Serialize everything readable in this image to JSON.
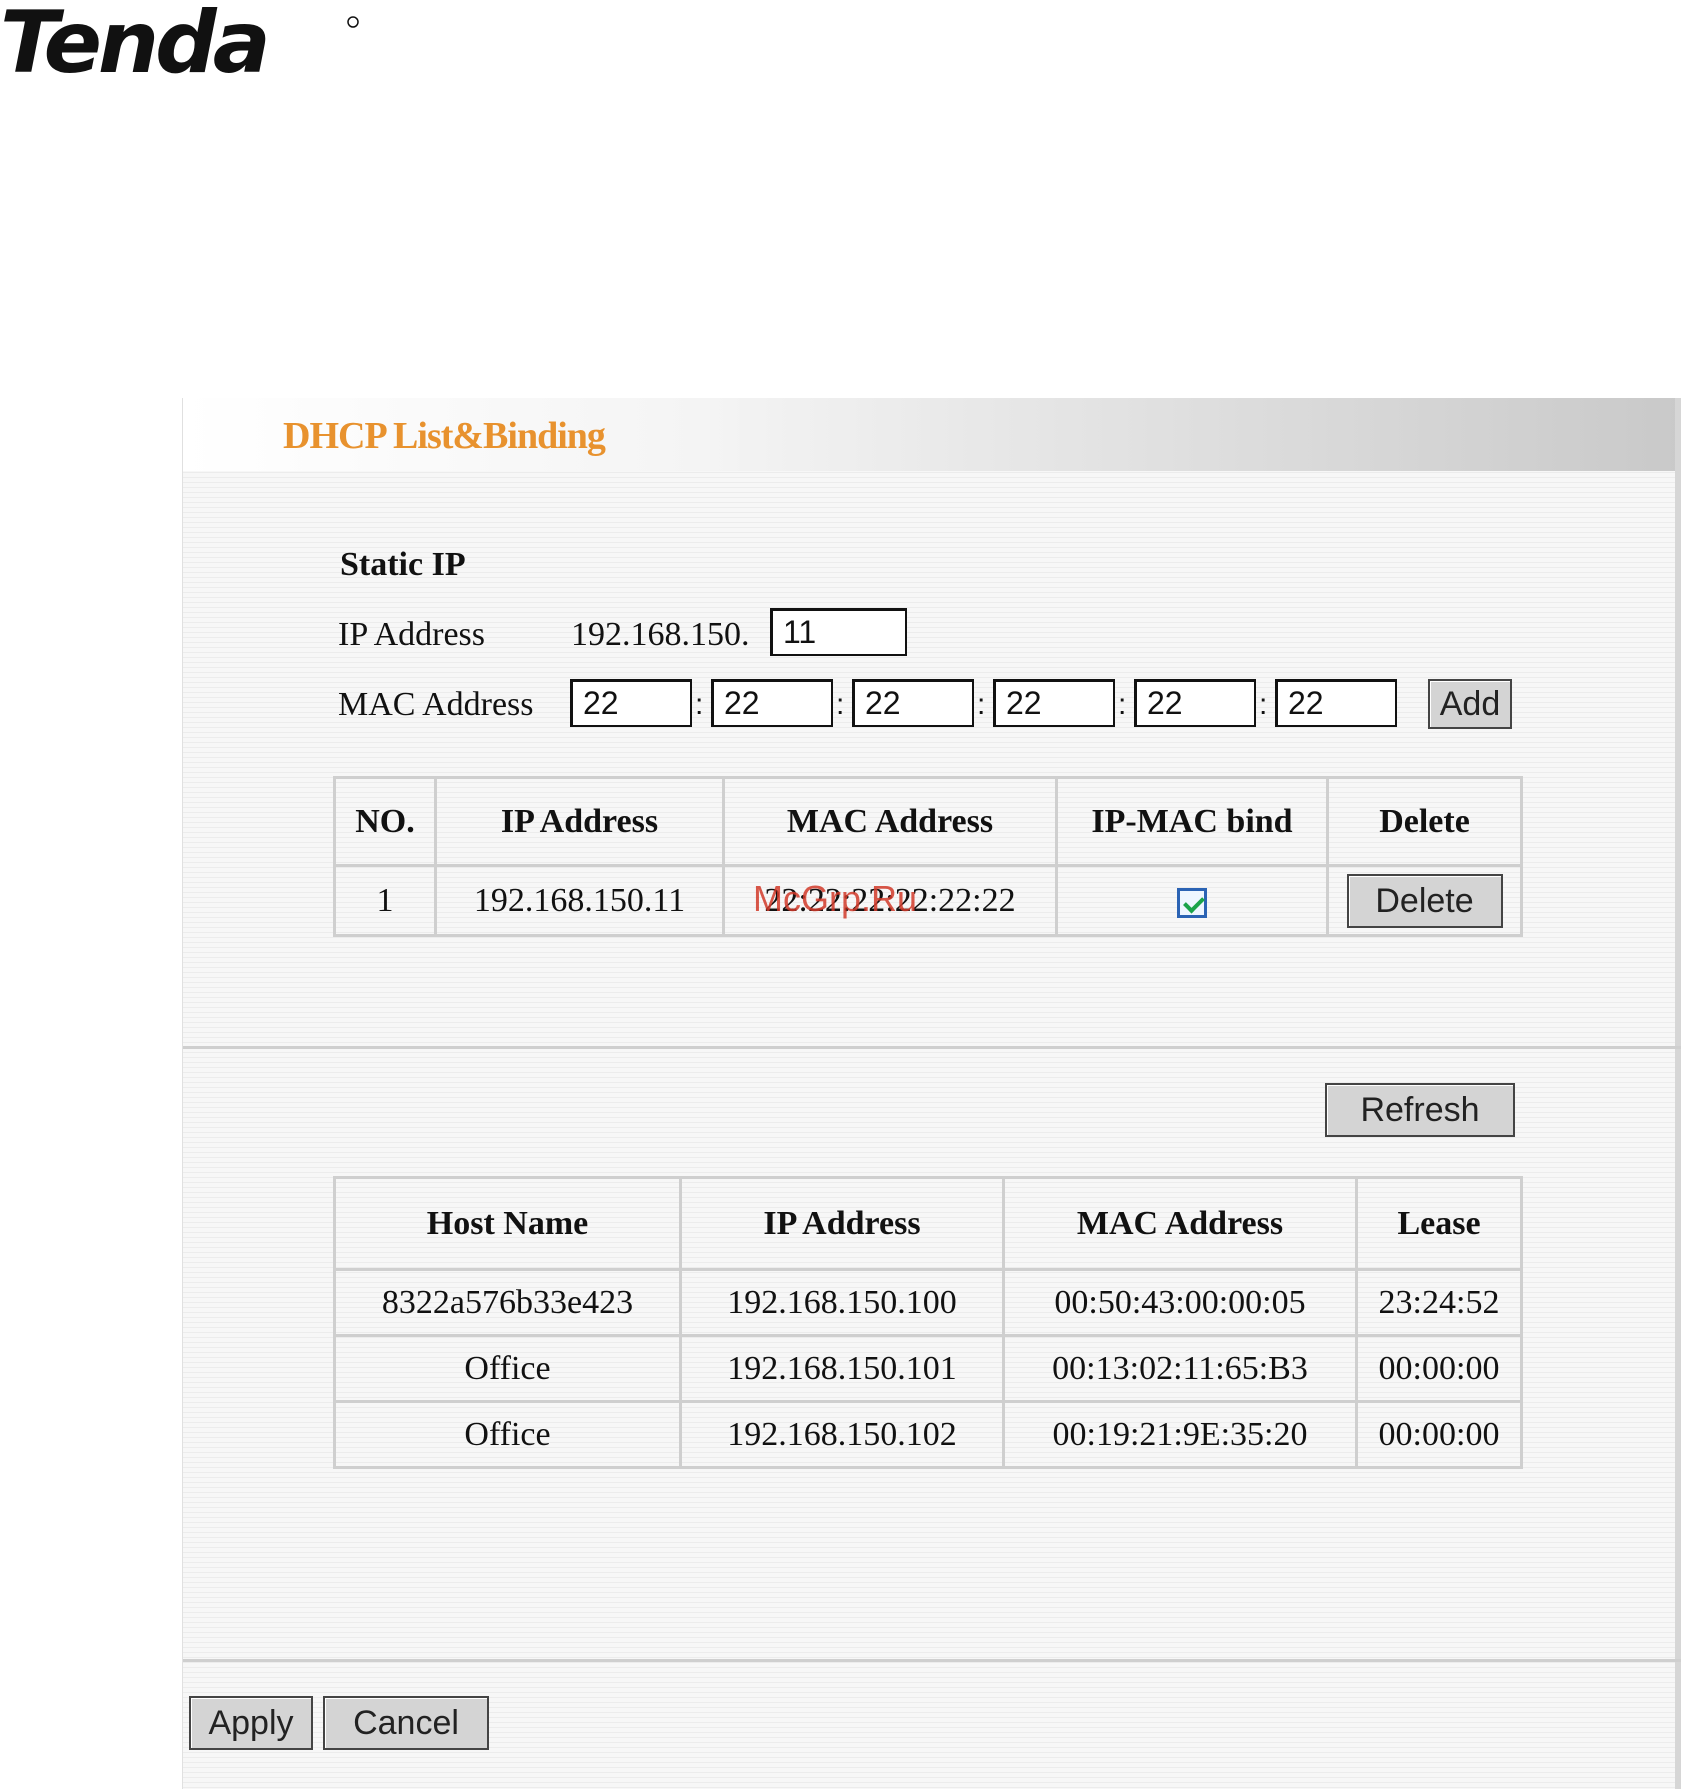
{
  "brand": {
    "logo_text": "Tenda"
  },
  "page": {
    "title": "DHCP List&Binding"
  },
  "static_ip": {
    "section_title": "Static IP",
    "ip_label": "IP Address",
    "ip_prefix": "192.168.150.",
    "ip_last_octet": "11",
    "mac_label": "MAC Address",
    "mac_octets": [
      "22",
      "22",
      "22",
      "22",
      "22",
      "22"
    ],
    "mac_separator": ":",
    "add_button": "Add"
  },
  "binding_table": {
    "headers": [
      "NO.",
      "IP Address",
      "MAC Address",
      "IP-MAC bind",
      "Delete"
    ],
    "rows": [
      {
        "no": "1",
        "ip": "192.168.150.11",
        "mac": "22:22:22:22:22:22",
        "bind_checked": true,
        "delete_label": "Delete"
      }
    ]
  },
  "watermark": "McGrp.Ru",
  "refresh_button": "Refresh",
  "clients_table": {
    "headers": [
      "Host Name",
      "IP Address",
      "MAC Address",
      "Lease"
    ],
    "rows": [
      {
        "host": "8322a576b33e423",
        "ip": "192.168.150.100",
        "mac": "00:50:43:00:00:05",
        "lease": "23:24:52"
      },
      {
        "host": "Office",
        "ip": "192.168.150.101",
        "mac": "00:13:02:11:65:B3",
        "lease": "00:00:00"
      },
      {
        "host": "Office",
        "ip": "192.168.150.102",
        "mac": "00:19:21:9E:35:20",
        "lease": "00:00:00"
      }
    ]
  },
  "footer": {
    "apply_button": "Apply",
    "cancel_button": "Cancel"
  },
  "colors": {
    "title": "#e8922e",
    "checkbox_border": "#2b63b4",
    "check_mark": "#1aa34a"
  }
}
